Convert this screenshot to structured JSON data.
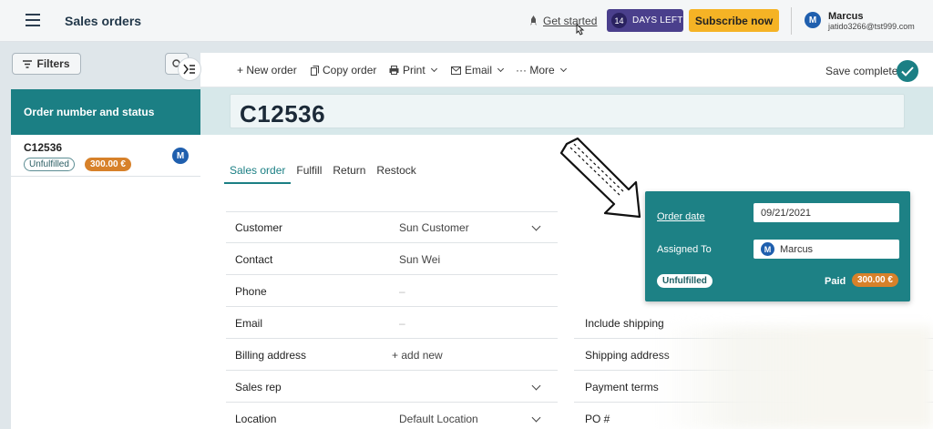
{
  "header": {
    "title": "Sales orders",
    "get_started": "Get started",
    "trial_days": "14",
    "trial_label": "DAYS LEFT",
    "subscribe": "Subscribe now",
    "user": {
      "initial": "M",
      "name": "Marcus",
      "email": "jatido3266@tst999.com"
    }
  },
  "left_panel": {
    "filters_label": "Filters",
    "list_header": "Order number and status",
    "items": [
      {
        "number": "C12536",
        "status": "Unfulfilled",
        "amount": "300.00 €",
        "avatar": "M"
      }
    ]
  },
  "toolbar": {
    "new_order": "+ New order",
    "copy_order": "Copy order",
    "print": "Print",
    "email": "Email",
    "more": "··· More",
    "save_status": "Save complete"
  },
  "order": {
    "title": "C12536",
    "tabs": [
      "Sales order",
      "Fulfill",
      "Return",
      "Restock"
    ],
    "fields": [
      {
        "label": "Customer",
        "value": "Sun Customer"
      },
      {
        "label": "Contact",
        "value": "Sun Wei"
      },
      {
        "label": "Phone",
        "value": "–"
      },
      {
        "label": "Email",
        "value": "–"
      },
      {
        "label": "Billing address",
        "value": "+ add new"
      },
      {
        "label": "Sales rep",
        "value": ""
      },
      {
        "label": "Location",
        "value": "Default Location"
      }
    ],
    "right_fields": [
      "Include shipping",
      "Shipping address",
      "Payment terms",
      "PO #"
    ]
  },
  "card": {
    "order_date_label": "Order date",
    "order_date": "09/21/2021",
    "assigned_label": "Assigned To",
    "assigned_initial": "M",
    "assigned_name": "Marcus",
    "status": "Unfulfilled",
    "paid_label": "Paid",
    "paid_amount": "300.00 €"
  },
  "colors": {
    "accent": "#1b7f84",
    "subscribe": "#f5b325",
    "amount_badge": "#d7812a",
    "trial": "#4a3f8c"
  }
}
